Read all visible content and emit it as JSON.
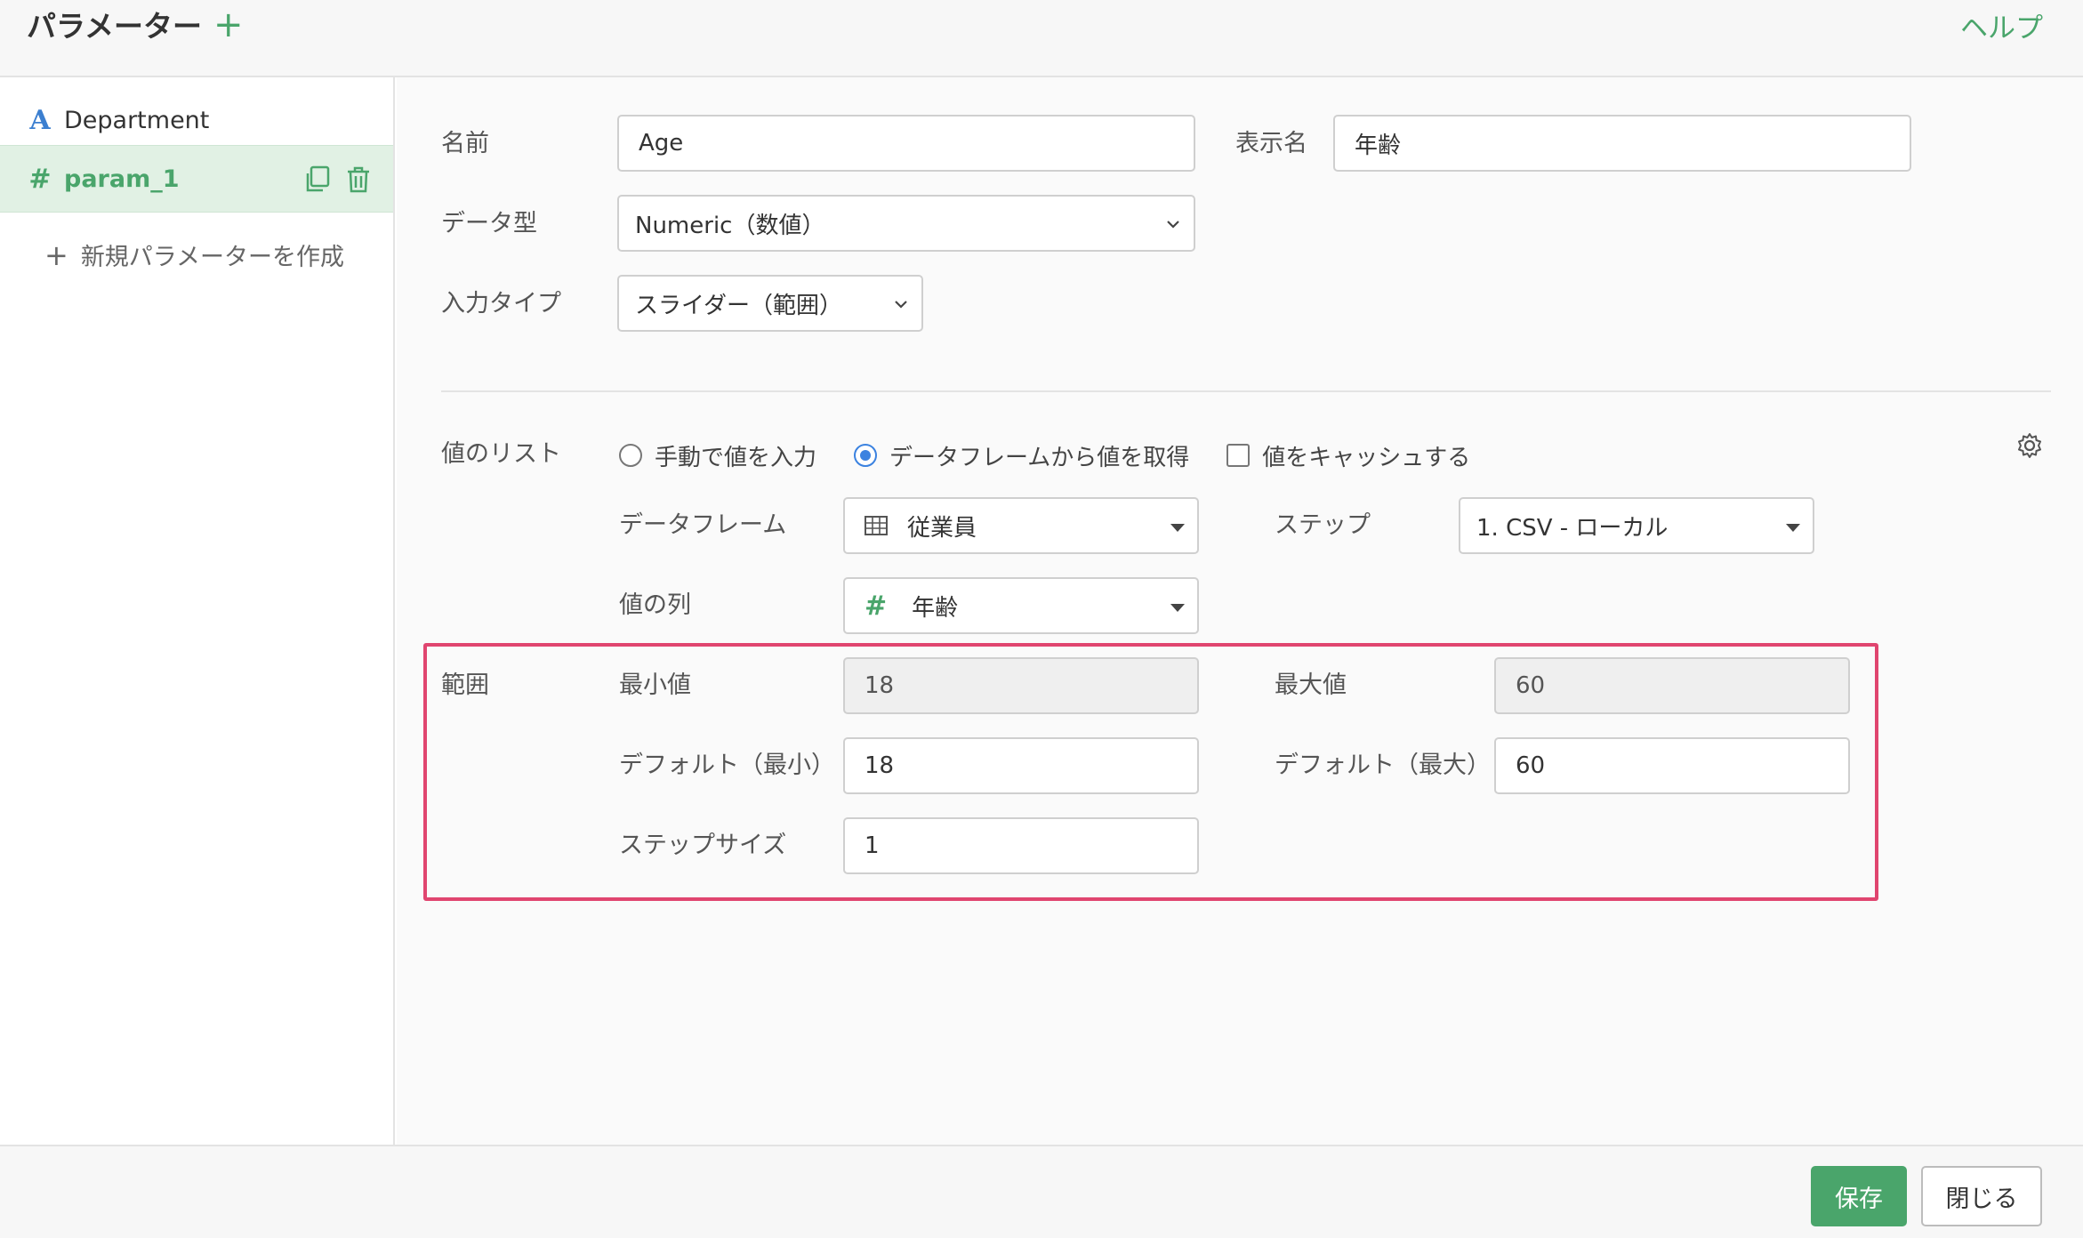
{
  "header": {
    "title": "パラメーター",
    "add_icon": "+",
    "help": "ヘルプ"
  },
  "sidebar": {
    "items": [
      {
        "type_icon": "A",
        "label": "Department"
      },
      {
        "type_icon": "#",
        "label": "param_1"
      }
    ],
    "new_param": "新規パラメーターを作成"
  },
  "form": {
    "name_label": "名前",
    "name_value": "Age",
    "display_name_label": "表示名",
    "display_name_value": "年齢",
    "data_type_label": "データ型",
    "data_type_value": "Numeric（数値）",
    "input_type_label": "入力タイプ",
    "input_type_value": "スライダー（範囲）",
    "value_list_label": "値のリスト",
    "opt_manual": "手動で値を入力",
    "opt_dataframe": "データフレームから値を取得",
    "opt_cache": "値をキャッシュする",
    "dataframe_label": "データフレーム",
    "dataframe_value": "従業員",
    "step_label": "ステップ",
    "step_value": "1. CSV - ローカル",
    "value_col_label": "値の列",
    "value_col_type": "#",
    "value_col_value": "年齢",
    "range_label": "範囲",
    "min_label": "最小値",
    "min_value": "18",
    "max_label": "最大値",
    "max_value": "60",
    "default_min_label": "デフォルト（最小）",
    "default_min_value": "18",
    "default_max_label": "デフォルト（最大）",
    "default_max_value": "60",
    "step_size_label": "ステップサイズ",
    "step_size_value": "1"
  },
  "footer": {
    "save": "保存",
    "close": "閉じる"
  },
  "colors": {
    "accent": "#4aa56b",
    "highlight": "#e0456f",
    "radio": "#3b82e0"
  }
}
